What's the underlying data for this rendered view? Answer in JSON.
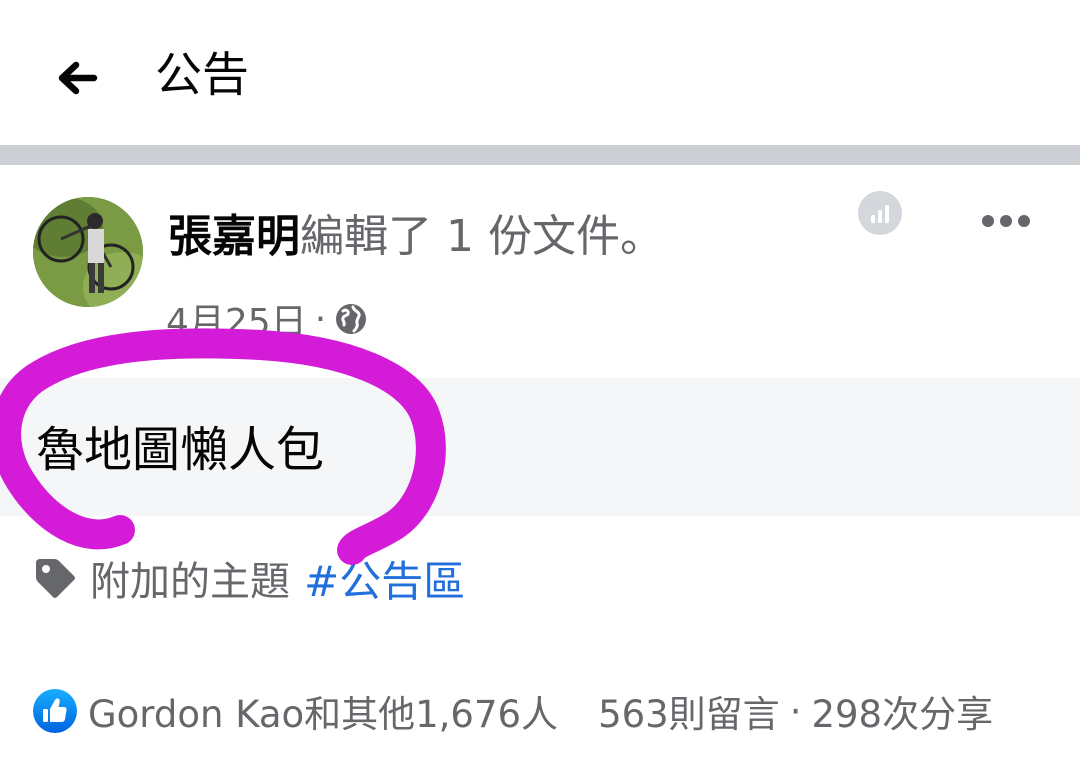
{
  "topbar": {
    "back_icon": "arrow-left-icon",
    "title": "公告"
  },
  "post": {
    "author": "張嘉明",
    "action": "編輯了 1 份文件。",
    "date": "4月25日",
    "separator": "·",
    "privacy_icon": "globe-icon",
    "insights_icon": "insights-icon",
    "more_icon": "more-dots-icon",
    "document_title": "魯地圖懶人包",
    "topic_icon": "tag-icon",
    "topic_label": "附加的主題",
    "topic_link": "#公告區"
  },
  "stats": {
    "like_icon": "like-thumb-icon",
    "reactions": "Gordon Kao和其他1,676人",
    "comments": "563則留言",
    "separator": "·",
    "shares": "298次分享"
  },
  "colors": {
    "link_blue": "#216fdb",
    "secondary_text": "#65676b",
    "divider": "#ccd0d5",
    "doc_background": "#f5f6f7",
    "annotation_magenta": "#d41cd8",
    "like_blue": "#1877f2"
  }
}
